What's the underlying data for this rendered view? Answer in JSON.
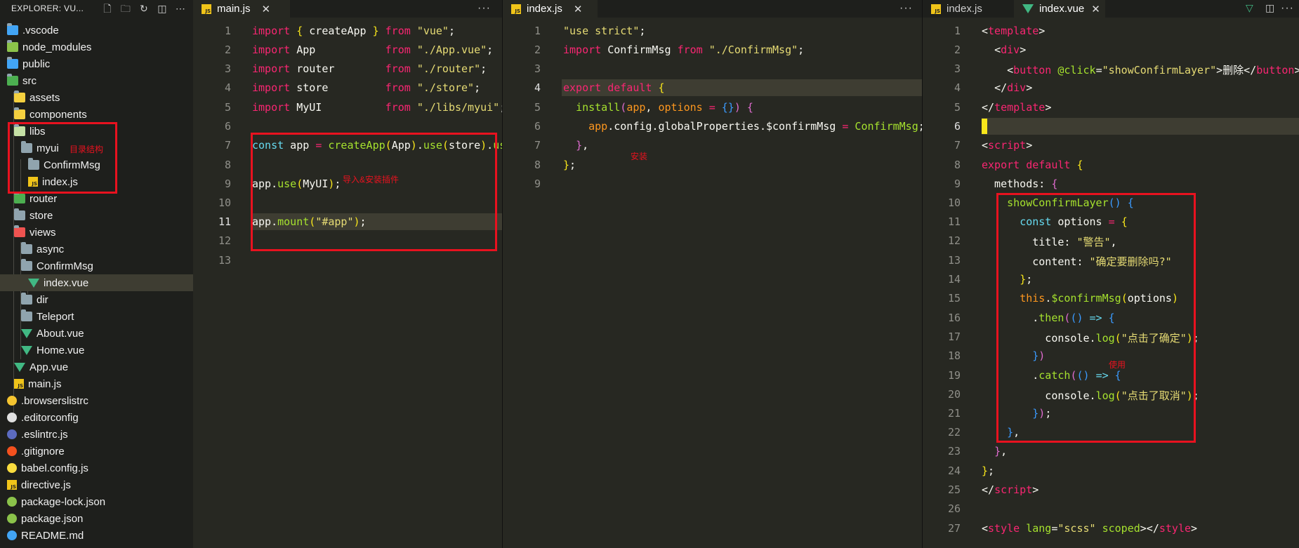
{
  "explorer": {
    "title": "EXPLORER: VU...",
    "icons": [
      "new-file-icon",
      "new-folder-icon",
      "refresh-icon",
      "collapse-icon",
      "more-icon"
    ],
    "items": [
      {
        "label": ".vscode",
        "icon": "vscode-folder-icon",
        "color": "#42a5f5"
      },
      {
        "label": "node_modules",
        "icon": "node-folder-icon",
        "color": "#8bc34a"
      },
      {
        "label": "public",
        "icon": "public-folder-icon",
        "color": "#42a5f5"
      },
      {
        "label": "src",
        "icon": "src-folder-icon",
        "color": "#4caf50"
      },
      {
        "label": "assets",
        "icon": "folder-icon",
        "color": "#f4d03f"
      },
      {
        "label": "components",
        "icon": "folder-icon",
        "color": "#f4d03f"
      },
      {
        "label": "libs",
        "icon": "libs-folder-icon",
        "color": "#c5e1a5"
      },
      {
        "label": "myui",
        "icon": "folder-icon",
        "color": "#90a4ae"
      },
      {
        "label": "ConfirmMsg",
        "icon": "folder-icon",
        "color": "#90a4ae"
      },
      {
        "label": "index.js",
        "icon": "js-file-icon",
        "color": "#f0c419"
      },
      {
        "label": "router",
        "icon": "router-folder-icon",
        "color": "#4caf50"
      },
      {
        "label": "store",
        "icon": "folder-icon",
        "color": "#90a4ae"
      },
      {
        "label": "views",
        "icon": "views-folder-icon",
        "color": "#ef5350"
      },
      {
        "label": "async",
        "icon": "folder-icon",
        "color": "#90a4ae"
      },
      {
        "label": "ConfirmMsg",
        "icon": "folder-icon",
        "color": "#90a4ae"
      },
      {
        "label": "index.vue",
        "icon": "vue-file-icon",
        "color": "#41b883"
      },
      {
        "label": "dir",
        "icon": "folder-icon",
        "color": "#90a4ae"
      },
      {
        "label": "Teleport",
        "icon": "folder-icon",
        "color": "#90a4ae"
      },
      {
        "label": "About.vue",
        "icon": "vue-file-icon",
        "color": "#41b883"
      },
      {
        "label": "Home.vue",
        "icon": "vue-file-icon",
        "color": "#41b883"
      },
      {
        "label": "App.vue",
        "icon": "vue-file-icon",
        "color": "#41b883"
      },
      {
        "label": "main.js",
        "icon": "js-file-icon",
        "color": "#f0c419"
      },
      {
        "label": ".browserslistrc",
        "icon": "browserslist-icon",
        "color": "#f4c430"
      },
      {
        "label": ".editorconfig",
        "icon": "editorconfig-icon",
        "color": "#e0e0e0"
      },
      {
        "label": ".eslintrc.js",
        "icon": "eslint-icon",
        "color": "#5c6bc0"
      },
      {
        "label": ".gitignore",
        "icon": "git-icon",
        "color": "#f4511e"
      },
      {
        "label": "babel.config.js",
        "icon": "babel-icon",
        "color": "#f9dc3e"
      },
      {
        "label": "directive.js",
        "icon": "js-file-icon",
        "color": "#f0c419"
      },
      {
        "label": "package-lock.json",
        "icon": "npm-icon",
        "color": "#8bc34a"
      },
      {
        "label": "package.json",
        "icon": "npm-icon",
        "color": "#8bc34a"
      },
      {
        "label": "README.md",
        "icon": "info-icon",
        "color": "#42a5f5"
      }
    ],
    "annotation": "目录结构"
  },
  "pane1": {
    "tab": "main.js",
    "annotation": "导入&安装插件"
  },
  "pane2": {
    "tab": "index.js",
    "annotation": "安装"
  },
  "pane3": {
    "tabs": [
      "index.js",
      "index.vue"
    ],
    "annotation": "使用"
  },
  "colors": {
    "background": "#272822",
    "sidebar": "#1e1f1c",
    "annotation_red": "#e8121f",
    "keyword": "#f92672",
    "string": "#e6db74",
    "function": "#a6e22e"
  }
}
